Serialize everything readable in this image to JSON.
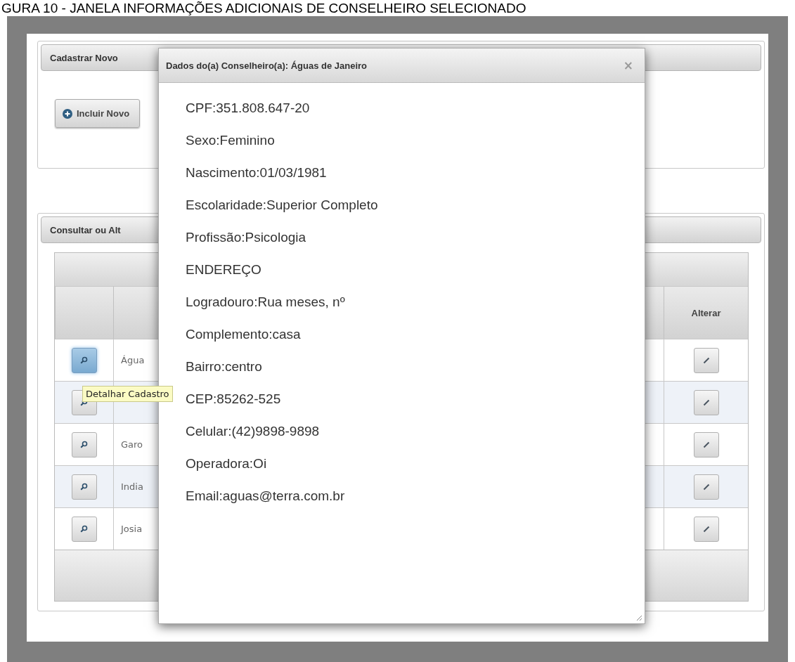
{
  "caption": "GURA 10 - JANELA INFORMAÇÕES ADICIONAIS DE CONSELHEIRO SELECIONADO",
  "panels": [
    {
      "kind": "form",
      "title": "Cadastrar Novo",
      "button": "Incluir Novo"
    },
    {
      "kind": "table",
      "title": "Consultar ou Alt",
      "columns": [
        "",
        "",
        "Alterar"
      ],
      "rows": [
        {
          "name": "Água",
          "active": true
        },
        {
          "name": "",
          "active": false
        },
        {
          "name": "Garo",
          "active": false
        },
        {
          "name": "India",
          "active": false
        },
        {
          "name": "Josia",
          "active": false
        }
      ]
    }
  ],
  "tooltip": {
    "text": "Detalhar Cadastro"
  },
  "dialog": {
    "title": "Dados do(a) Conselheiro(a): Águas de Janeiro",
    "close": "×",
    "lines": [
      "CPF:351.808.647-20",
      "Sexo:Feminino",
      "Nascimento:01/03/1981",
      "Escolaridade:Superior Completo",
      "Profissão:Psicologia",
      "ENDEREÇO",
      "Logradouro:Rua meses, nº",
      "Complemento:casa",
      "Bairro:centro",
      "CEP:85262-525",
      "Celular:(42)9898-9898",
      "Operadora:Oi",
      "Email:aguas@terra.com.br"
    ]
  }
}
